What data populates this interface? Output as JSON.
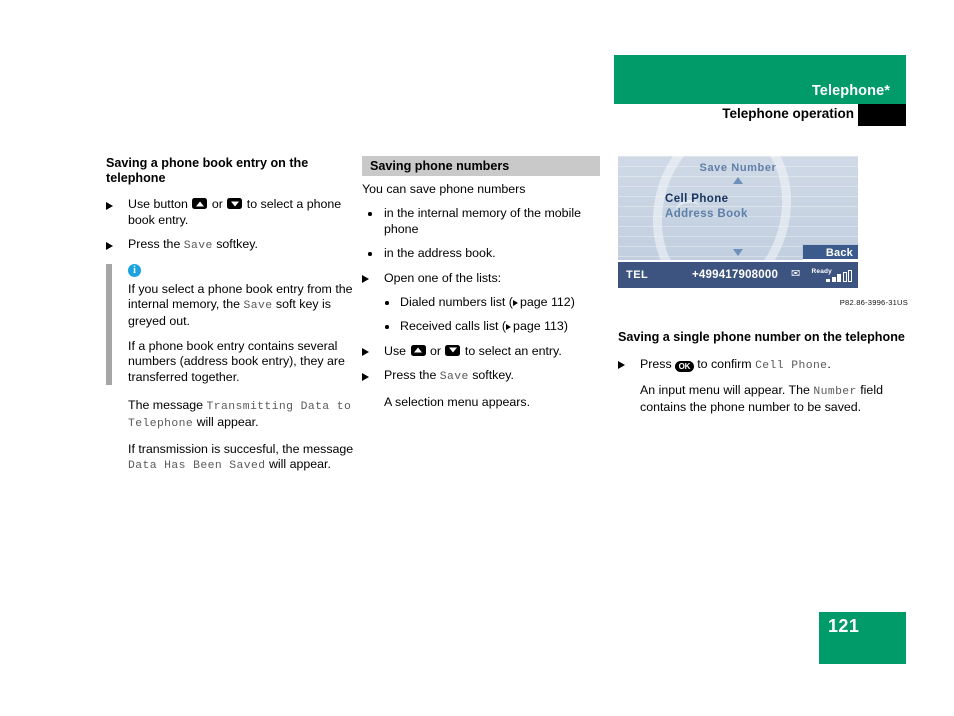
{
  "header": {
    "chapter_title": "Telephone*",
    "section_title": "Telephone operation",
    "green_hex": "#009b68"
  },
  "left_column": {
    "heading": "Saving a phone book entry on the telephone",
    "step_1": {
      "prefix": "Use button",
      "key_up": "up-arrow-key",
      "middle": "or",
      "key_down": "down-arrow-key",
      "suffix": "to select a phone book entry."
    },
    "step_2": {
      "prefix": "Press the",
      "code": "Save",
      "suffix": "softkey."
    },
    "note_icon": "i",
    "note_1_a": "If you select a phone book entry from the internal memory, the",
    "note_1_code": "Save",
    "note_1_b": "soft key is greyed out.",
    "note_2": "If a phone book entry contains several numbers (address book entry), they are transferred together.",
    "para_1_a": "The message",
    "para_1_code": "Transmitting Data to Telephone",
    "para_1_b": "will appear.",
    "para_2_a": "If transmission is succesful, the message",
    "para_2_code": "Data Has Been Saved",
    "para_2_b": "will appear."
  },
  "middle_column": {
    "shaded_heading": "Saving phone numbers",
    "intro": "You can save phone numbers",
    "bullets": [
      "in the internal memory of the mobile phone",
      "in the address book."
    ],
    "step_open": "Open one of the lists:",
    "sub_bullets": [
      {
        "text": "Dialed numbers list (",
        "page_label": "page 112",
        "close": ")"
      },
      {
        "text": "Received calls list (",
        "page_label": "page 113",
        "close": ")"
      }
    ],
    "step_use": {
      "prefix": "Use",
      "key_up": "up-arrow-key",
      "middle": "or",
      "key_down": "down-arrow-key",
      "suffix": "to select an entry."
    },
    "step_press": {
      "prefix": "Press the",
      "code": "Save",
      "suffix": "softkey."
    },
    "result": "A selection menu appears."
  },
  "right_column": {
    "display": {
      "title": "Save Number",
      "scroll_up_icon": "triangle-up-icon",
      "scroll_down_icon": "triangle-down-icon",
      "item_selected": "Cell Phone",
      "item_other": "Address Book",
      "softkey_back": "Back",
      "status_mode": "TEL",
      "status_number": "+499417908000",
      "status_message_icon": "envelope-icon",
      "status_ready": "Ready",
      "signal_bars_filled": 3,
      "signal_bars_empty": 2
    },
    "figure_caption": "P82.86-3996-31US",
    "heading": "Saving a single phone number on the telephone",
    "step_press": {
      "prefix": "Press",
      "key": "ok-key",
      "key_label": "OK",
      "middle": "to confirm",
      "code": "Cell Phone",
      "suffix": "."
    },
    "result_a": "An input menu will appear. The",
    "result_code": "Number",
    "result_b": "field contains the phone number to be saved."
  },
  "footer": {
    "page_number": "121"
  }
}
